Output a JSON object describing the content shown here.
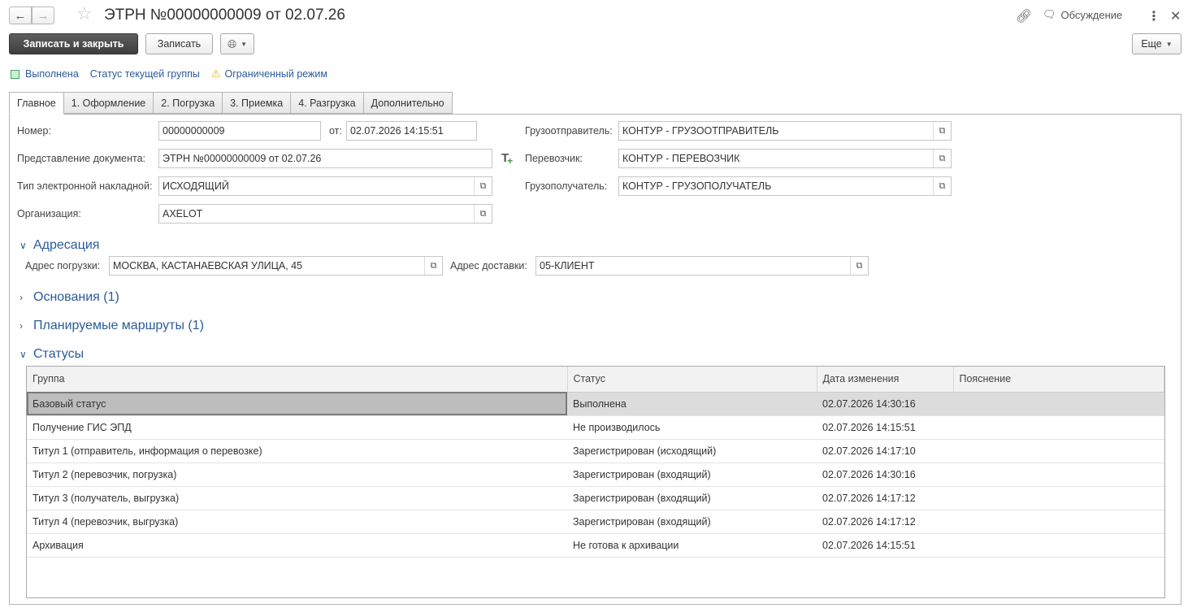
{
  "window": {
    "title": "ЭТРН  №00000000009 от 02.07.26",
    "discussion_label": "Обсуждение"
  },
  "toolbar": {
    "save_close_label": "Записать и закрыть",
    "save_label": "Записать",
    "more_label": "Еще"
  },
  "status_line": {
    "completed_label": "Выполнена",
    "group_status_label": "Статус текущей группы",
    "limited_mode_label": "Ограниченный режим"
  },
  "tabs": [
    {
      "label": "Главное"
    },
    {
      "label": "1. Оформление"
    },
    {
      "label": "2. Погрузка"
    },
    {
      "label": "3. Приемка"
    },
    {
      "label": "4. Разгрузка"
    },
    {
      "label": "Дополнительно"
    }
  ],
  "form": {
    "number_label": "Номер:",
    "number_value": "00000000009",
    "date_label": "от:",
    "date_value": "02.07.2026 14:15:51",
    "presentation_label": "Представление документа:",
    "presentation_value": "ЭТРН  №00000000009 от 02.07.26",
    "type_label": "Тип электронной накладной:",
    "type_value": "ИСХОДЯЩИЙ",
    "org_label": "Организация:",
    "org_value": "AXELOT",
    "shipper_label": "Грузоотправитель:",
    "shipper_value": "КОНТУР - ГРУЗООТПРАВИТЕЛЬ",
    "carrier_label": "Перевозчик:",
    "carrier_value": "КОНТУР - ПЕРЕВОЗЧИК",
    "consignee_label": "Грузополучатель:",
    "consignee_value": "КОНТУР - ГРУЗОПОЛУЧАТЕЛЬ"
  },
  "addressing": {
    "title": "Адресация",
    "loading_label": "Адрес погрузки:",
    "loading_value": "МОСКВА, КАСТАНАЕВСКАЯ УЛИЦА, 45",
    "delivery_label": "Адрес доставки:",
    "delivery_value": "05-КЛИЕНТ"
  },
  "sections": {
    "grounds": "Основания (1)",
    "routes": "Планируемые маршруты (1)",
    "statuses": "Статусы"
  },
  "statuses_table": {
    "columns": [
      "Группа",
      "Статус",
      "Дата изменения",
      "Пояснение"
    ],
    "rows": [
      {
        "group": "Базовый статус",
        "status": "Выполнена",
        "date": "02.07.2026 14:30:16",
        "note": ""
      },
      {
        "group": "Получение ГИС ЭПД",
        "status": "Не производилось",
        "date": "02.07.2026 14:15:51",
        "note": ""
      },
      {
        "group": "Титул 1 (отправитель, информация о перевозке)",
        "status": "Зарегистрирован (исходящий)",
        "date": "02.07.2026 14:17:10",
        "note": ""
      },
      {
        "group": "Титул 2 (перевозчик, погрузка)",
        "status": "Зарегистрирован (входящий)",
        "date": "02.07.2026 14:30:16",
        "note": ""
      },
      {
        "group": "Титул 3 (получатель, выгрузка)",
        "status": "Зарегистрирован (входящий)",
        "date": "02.07.2026 14:17:12",
        "note": ""
      },
      {
        "group": "Титул 4 (перевозчик, выгрузка)",
        "status": "Зарегистрирован (входящий)",
        "date": "02.07.2026 14:17:12",
        "note": ""
      },
      {
        "group": "Архивация",
        "status": "Не готова к архивации",
        "date": "02.07.2026 14:15:51",
        "note": ""
      }
    ]
  }
}
